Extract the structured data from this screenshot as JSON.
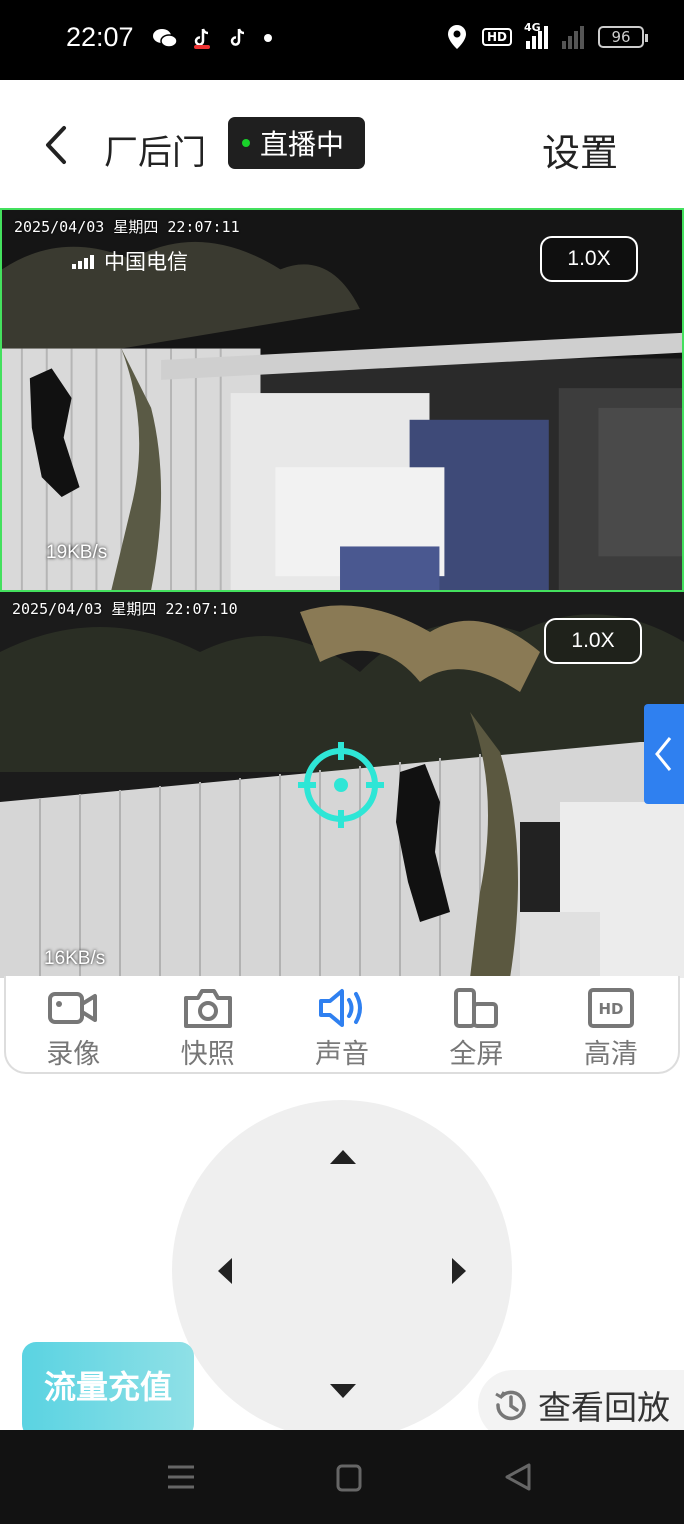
{
  "status_bar": {
    "time": "22:07",
    "network": "4G",
    "hd_label": "HD",
    "battery": "96"
  },
  "header": {
    "camera_name": "厂后门",
    "live_label": "直播中",
    "settings_label": "设置"
  },
  "feeds": [
    {
      "timestamp": "2025/04/03 星期四 22:07:11",
      "carrier": "中国电信",
      "zoom": "1.0X",
      "speed": "19KB/s",
      "selected": true
    },
    {
      "timestamp": "2025/04/03 星期四 22:07:10",
      "zoom": "1.0X",
      "speed": "16KB/s",
      "selected": false
    }
  ],
  "toolbar": {
    "items": [
      {
        "label": "录像",
        "icon": "video-camera-icon"
      },
      {
        "label": "快照",
        "icon": "camera-icon"
      },
      {
        "label": "声音",
        "icon": "speaker-icon",
        "active": true
      },
      {
        "label": "全屏",
        "icon": "fullscreen-icon"
      },
      {
        "label": "高清",
        "icon": "hd-icon"
      }
    ]
  },
  "ptz": {
    "directions": [
      "up",
      "left",
      "right",
      "down"
    ]
  },
  "recharge_label": "流量充值",
  "playback_label": "查看回放",
  "colors": {
    "accent_blue": "#2f80f0",
    "live_dot": "#19d12a",
    "selected_border": "#44e05e",
    "crosshair": "#2ee6d6"
  }
}
